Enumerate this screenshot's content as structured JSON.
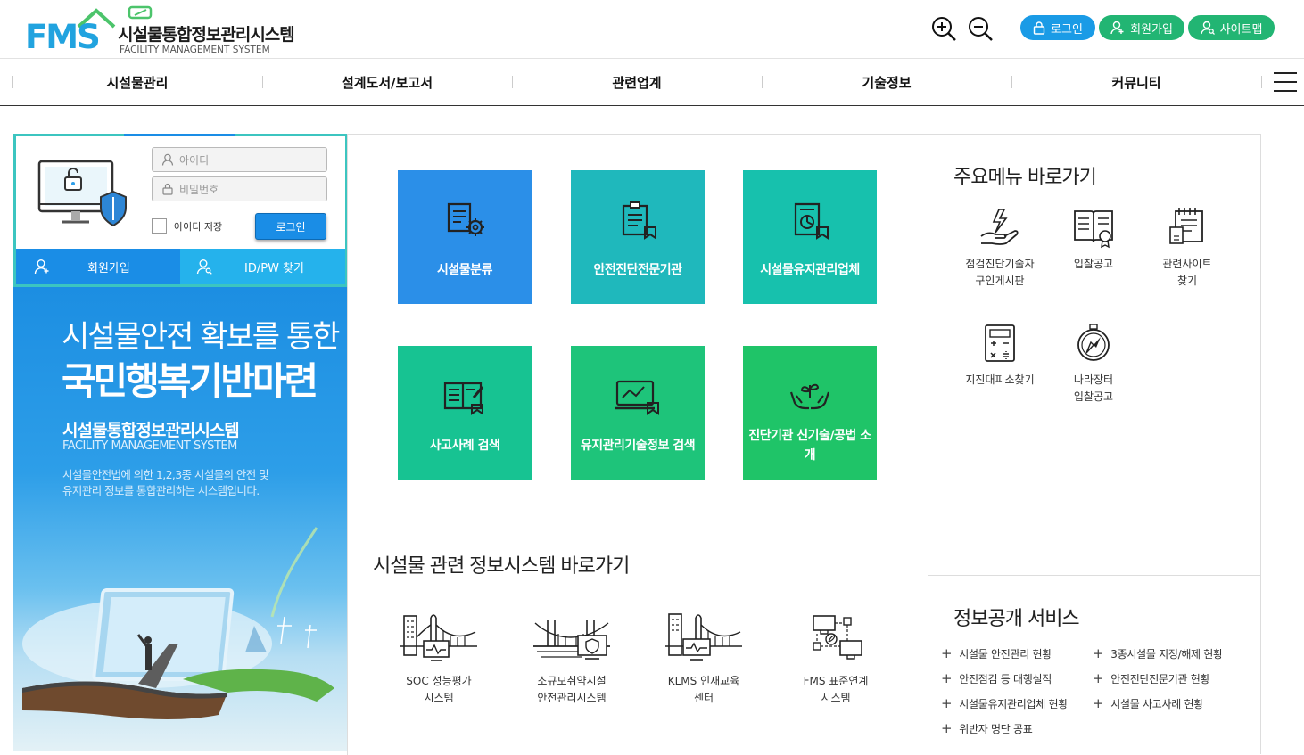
{
  "header": {
    "logo_text": "FMS",
    "logo_title": "시설물통합정보관리시스템",
    "logo_subtitle": "FACILITY MANAGEMENT SYSTEM",
    "login_label": "로그인",
    "signup_label": "회원가입",
    "sitemap_label": "사이트맵",
    "button_color": "#1a9be6",
    "button_color_green": "#22b573"
  },
  "nav": {
    "items": [
      {
        "label": "시설물관리"
      },
      {
        "label": "설계도서/보고서"
      },
      {
        "label": "관련업계"
      },
      {
        "label": "기술정보"
      },
      {
        "label": "커뮤니티"
      }
    ]
  },
  "login": {
    "id_placeholder": "아이디",
    "pw_placeholder": "비밀번호",
    "save_id_label": "아이디 저장",
    "login_button": "로그인",
    "signup_tab": "회원가입",
    "find_tab": "ID/PW 찾기",
    "accent": "#3cc5c0"
  },
  "banner": {
    "line1": "시설물안전 확보를 통한",
    "line2": "국민행복기반마련",
    "line3": "시설물통합정보관리시스템",
    "line4": "FACILITY MANAGEMENT SYSTEM",
    "desc1": "시설물안전법에 의한 1,2,3종 시설물의 안전 및",
    "desc2": "유지관리 정보를 통합관리하는 시스템입니다."
  },
  "tiles": [
    {
      "label": "시설물분류",
      "icon": "document-gear-icon",
      "color": "#2b8fe8"
    },
    {
      "label": "안전진단전문기관",
      "icon": "clipboard-icon",
      "color": "#1fb8bc"
    },
    {
      "label": "시설물유지관리업체",
      "icon": "chart-document-icon",
      "color": "#17c1ad"
    },
    {
      "label": "사고사례 검색",
      "icon": "book-pen-icon",
      "color": "#17c392"
    },
    {
      "label": "유지관리기술정보 검색",
      "icon": "monitor-graph-icon",
      "color": "#1ec47a"
    },
    {
      "label": "진단기관 신기술/공법 소개",
      "icon": "hands-plant-icon",
      "color": "#1fc468"
    }
  ],
  "info_systems": {
    "title": "시설물 관련 정보시스템 바로가기",
    "items": [
      {
        "label1": "SOC 성능평가",
        "label2": "시스템",
        "icon": "city-bridge-icon"
      },
      {
        "label1": "소규모취약시설",
        "label2": "안전관리시스템",
        "icon": "bridge-shield-icon"
      },
      {
        "label1": "KLMS 인재교육",
        "label2": "센터",
        "icon": "city-monitor-icon"
      },
      {
        "label1": "FMS 표준연계",
        "label2": "시스템",
        "icon": "network-icon"
      }
    ]
  },
  "main_menu": {
    "title": "주요메뉴 바로가기",
    "items": [
      {
        "label1": "점검진단기술자",
        "label2": "구인게시판",
        "icon": "hand-bolt-icon"
      },
      {
        "label1": "입찰공고",
        "label2": "",
        "icon": "book-badge-icon"
      },
      {
        "label1": "관련사이트",
        "label2": "찾기",
        "icon": "notepad-icon"
      },
      {
        "label1": "지진대피소찾기",
        "label2": "",
        "icon": "calculator-icon"
      },
      {
        "label1": "나라장터",
        "label2": "입찰공고",
        "icon": "compass-icon"
      }
    ]
  },
  "info_service": {
    "title": "정보공개 서비스",
    "items": [
      "시설물 안전관리 현황",
      "3종시설물 지정/해제 현황",
      "안전점검 등 대행실적",
      "안전진단전문기관 현황",
      "시설물유지관리업체 현황",
      "시설물 사고사례 현황",
      "위반자 명단 공표"
    ]
  }
}
